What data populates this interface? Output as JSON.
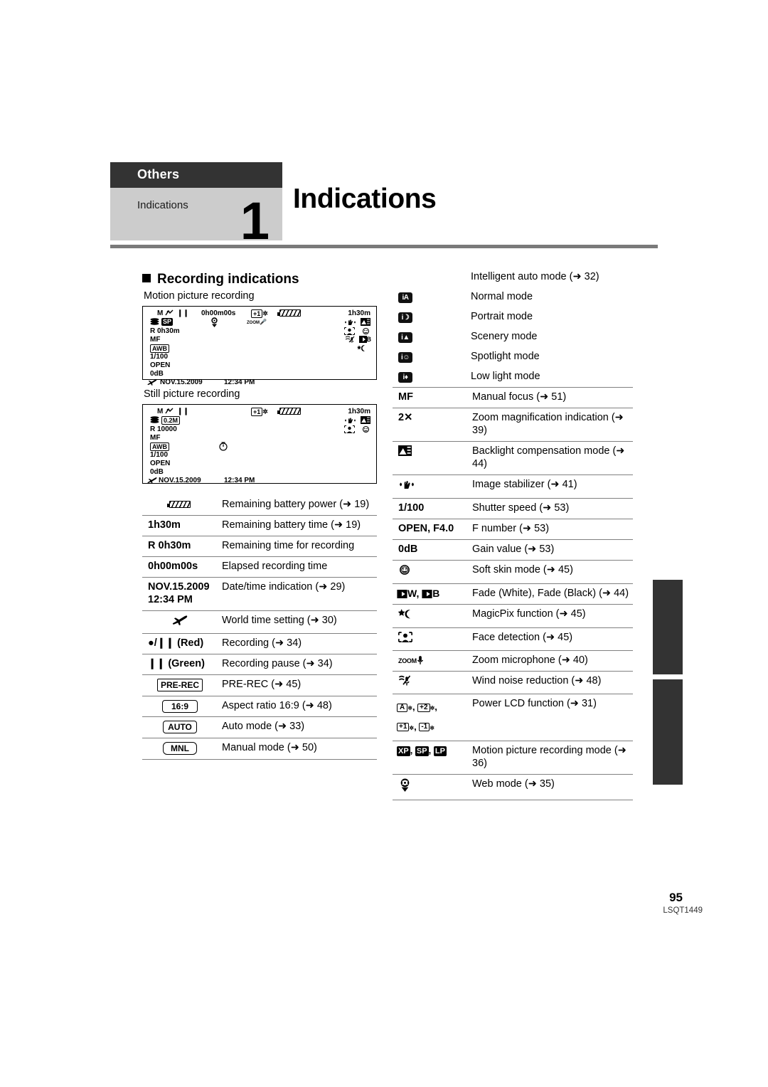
{
  "header": {
    "section_label": "Others",
    "subsection_label": "Indications",
    "chapter_number": "1",
    "title": "Indications"
  },
  "section": {
    "heading": "Recording indications"
  },
  "lcd": {
    "motion": {
      "caption": "Motion picture recording",
      "mode_m": "M",
      "pause": "❙❙",
      "elapsed": "0h00m00s",
      "lcd_level": "+1",
      "battery_time": "1h30m",
      "quality": "SP",
      "remaining": "R   0h30m",
      "zoom_mic": "ZOOM",
      "focus": "MF",
      "wb": "AWB",
      "shutter": "1/100",
      "fnumber": "OPEN",
      "gain": "0dB",
      "date": "NOV.15.2009",
      "time": "12:34 PM",
      "fade": "B"
    },
    "still": {
      "caption": "Still picture recording",
      "mode_m": "M",
      "pause": "❙❙",
      "lcd_level": "+1",
      "battery_time": "1h30m",
      "pixels": "0.2M",
      "remaining": "R  10000",
      "focus": "MF",
      "wb": "AWB",
      "shutter": "1/100",
      "fnumber": "OPEN",
      "gain": "0dB",
      "date": "NOV.15.2009",
      "time": "12:34 PM"
    }
  },
  "left_table": {
    "rows": [
      {
        "symbol_kind": "battery-icon",
        "symbol": "",
        "desc": "Remaining battery power (➜ 19)"
      },
      {
        "symbol_kind": "text",
        "symbol": "1h30m",
        "desc": "Remaining battery time (➜ 19)"
      },
      {
        "symbol_kind": "text",
        "symbol": "R  0h30m",
        "desc": "Remaining time for recording"
      },
      {
        "symbol_kind": "text",
        "symbol": "0h00m00s",
        "desc": "Elapsed recording time"
      },
      {
        "symbol_kind": "text2",
        "symbol": "NOV.15.2009",
        "symbol2": "12:34 PM",
        "desc": "Date/time indication (➜ 29)"
      },
      {
        "symbol_kind": "plane-icon",
        "symbol": "",
        "desc": "World time setting (➜ 30)"
      },
      {
        "symbol_kind": "text",
        "symbol": "●/❙❙ (Red)",
        "desc": "Recording (➜ 34)"
      },
      {
        "symbol_kind": "text",
        "symbol": "❙❙ (Green)",
        "desc": "Recording pause (➜ 34)"
      },
      {
        "symbol_kind": "boxed",
        "symbol": "PRE-REC",
        "desc": "PRE-REC (➜ 45)"
      },
      {
        "symbol_kind": "boxed",
        "symbol": "16:9",
        "desc": "Aspect ratio 16:9 (➜ 48)"
      },
      {
        "symbol_kind": "boxed",
        "symbol": "AUTO",
        "desc": "Auto mode (➜ 33)"
      },
      {
        "symbol_kind": "boxed",
        "symbol": "MNL",
        "desc": "Manual mode (➜ 50)"
      }
    ]
  },
  "right_table": {
    "modes": [
      {
        "icon": "",
        "icon_kind": "none",
        "desc": "Intelligent auto mode (➜ 32)"
      },
      {
        "icon": "iA",
        "icon_kind": "mode",
        "desc": "Normal mode"
      },
      {
        "icon": "i☽",
        "icon_kind": "mode",
        "desc": "Portrait mode"
      },
      {
        "icon": "i▲",
        "icon_kind": "mode",
        "desc": "Scenery mode"
      },
      {
        "icon": "i☺",
        "icon_kind": "mode",
        "desc": "Spotlight mode"
      },
      {
        "icon": "i♦",
        "icon_kind": "mode",
        "desc": "Low light mode"
      }
    ],
    "rows": [
      {
        "symbol_kind": "text",
        "symbol": "MF",
        "desc": "Manual focus (➜ 51)"
      },
      {
        "symbol_kind": "text",
        "symbol": "2✕",
        "desc": "Zoom magnification indication (➜ 39)"
      },
      {
        "symbol_kind": "backlight-icon",
        "symbol": "",
        "desc": "Backlight compensation mode (➜ 44)"
      },
      {
        "symbol_kind": "stabilizer-icon",
        "symbol": "",
        "desc": "Image stabilizer (➜ 41)"
      },
      {
        "symbol_kind": "text",
        "symbol": "1/100",
        "desc": "Shutter speed (➜ 53)"
      },
      {
        "symbol_kind": "text",
        "symbol": "OPEN, F4.0",
        "desc": "F number (➜ 53)"
      },
      {
        "symbol_kind": "text",
        "symbol": "0dB",
        "desc": "Gain value (➜ 53)"
      },
      {
        "symbol_kind": "softskin-icon",
        "symbol": "",
        "desc": "Soft skin mode (➜ 45)"
      },
      {
        "symbol_kind": "fade-icon",
        "symbol": "W, B",
        "desc": "Fade (White), Fade (Black) (➜ 44)"
      },
      {
        "symbol_kind": "magicpix-icon",
        "symbol": "",
        "desc": "MagicPix function (➜ 45)"
      },
      {
        "symbol_kind": "facedetect-icon",
        "symbol": "",
        "desc": "Face detection (➜ 45)"
      },
      {
        "symbol_kind": "zoommic-icon",
        "symbol": "ZOOM",
        "desc": "Zoom microphone (➜ 40)"
      },
      {
        "symbol_kind": "windnoise-icon",
        "symbol": "",
        "desc": "Wind noise reduction (➜ 48)"
      },
      {
        "symbol_kind": "powerlcd-icon",
        "symbol": "A, +2, +1, -1",
        "desc": "Power LCD function (➜ 31)"
      },
      {
        "symbol_kind": "recmode-icon",
        "symbol": "XP, SP, LP",
        "desc": "Motion picture recording mode (➜ 36)"
      },
      {
        "symbol_kind": "webmode-icon",
        "symbol": "",
        "desc": "Web mode (➜ 35)"
      }
    ]
  },
  "footer": {
    "page_number": "95",
    "doc_code": "LSQT1449"
  }
}
